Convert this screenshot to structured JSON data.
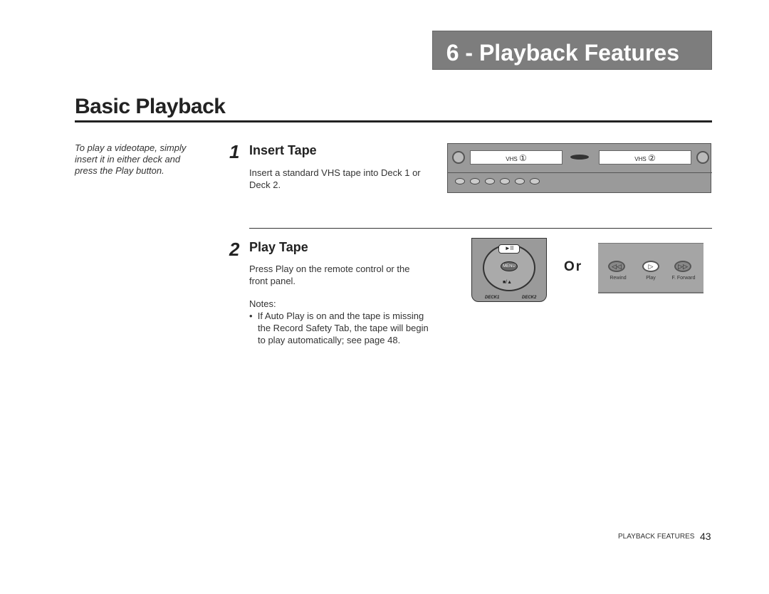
{
  "chapter_header": "6 - Playback Features",
  "title": "Basic Playback",
  "side_note": "To play a videotape, simply insert it in either deck and press the Play button.",
  "steps": [
    {
      "number": "1",
      "heading": "Insert Tape",
      "text": "Insert a standard VHS tape into Deck 1 or Deck 2."
    },
    {
      "number": "2",
      "heading": "Play Tape",
      "text": "Press Play on the remote control or the front panel.",
      "notes_label": "Notes:",
      "notes": [
        "If Auto Play is on and the tape is missing the Record Safety Tab, the tape will begin to play automatically; see page 48."
      ]
    }
  ],
  "vcr": {
    "deck1_marker": "①",
    "deck2_marker": "②",
    "deck_label": "VHS"
  },
  "remote": {
    "play_pause": "►II",
    "menu": "MENU",
    "stop_eject": "■/▲",
    "deck1": "DECK1",
    "deck2": "DECK2"
  },
  "or_label": "Or",
  "front_panel": {
    "buttons": [
      {
        "icon": "◁◁",
        "label": "Rewind"
      },
      {
        "icon": "▷",
        "label": "Play"
      },
      {
        "icon": "▷▷",
        "label": "F. Forward"
      }
    ]
  },
  "footer": {
    "section": "PLAYBACK FEATURES",
    "page": "43"
  }
}
